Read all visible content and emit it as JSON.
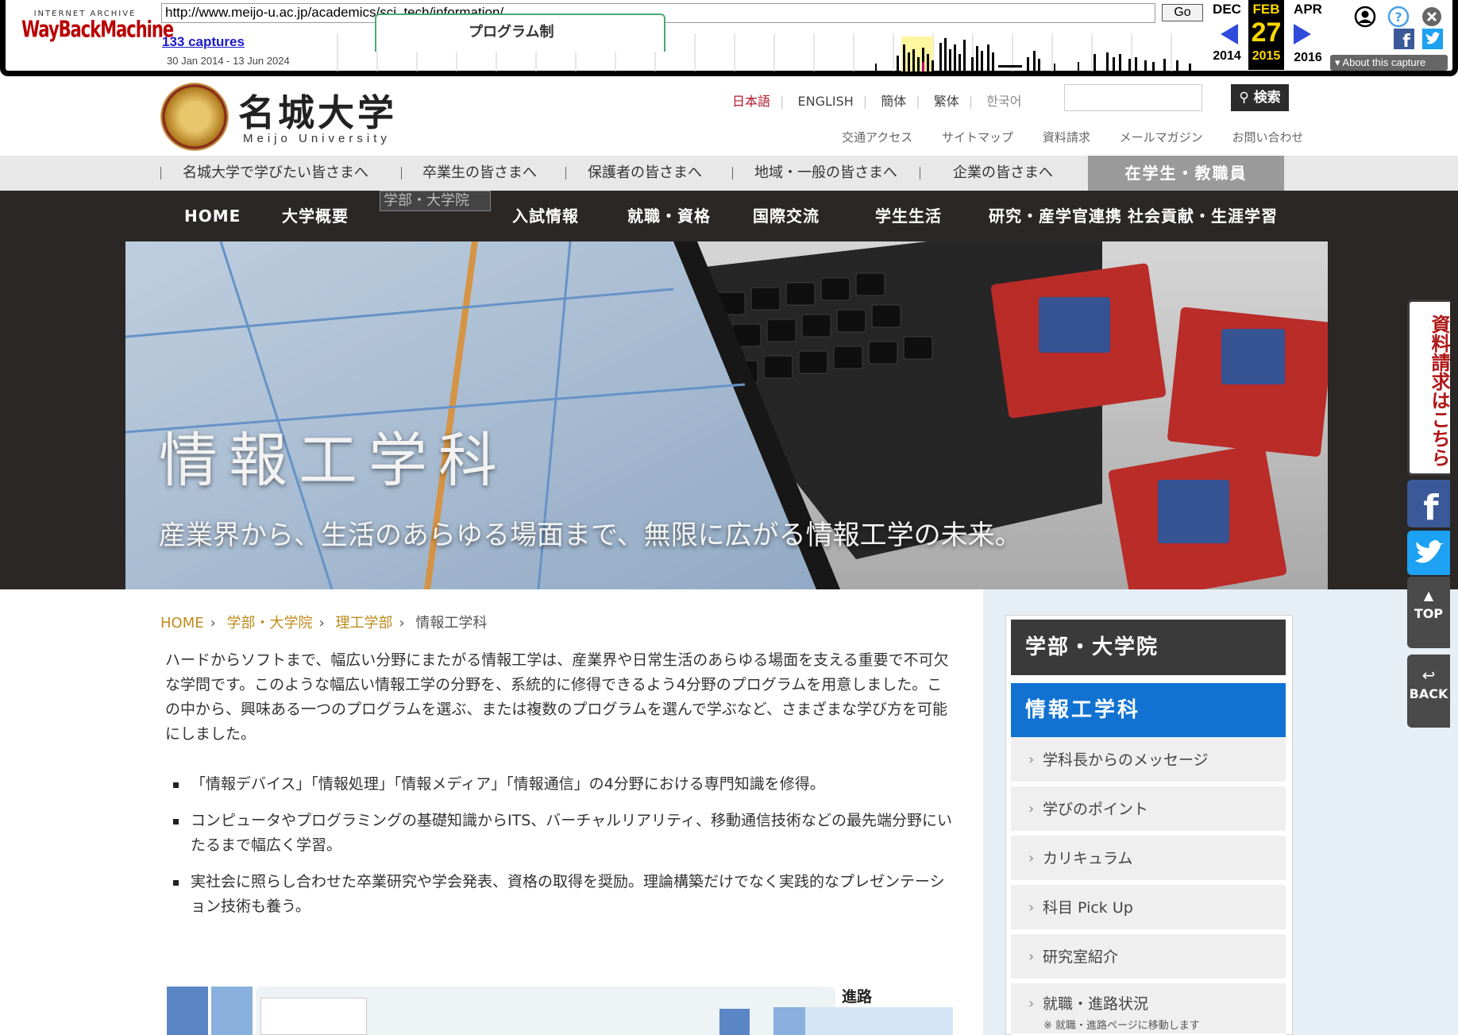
{
  "wayback": {
    "logo_top": "INTERNET ARCHIVE",
    "logo_main": "WayBackMachine",
    "url": "http://www.meijo-u.ac.jp/academics/sci_tech/information/",
    "go": "Go",
    "captures": "133 captures",
    "range": "30 Jan 2014 - 13 Jun 2024",
    "prev_month": "DEC",
    "cur_month": "FEB",
    "next_month": "APR",
    "day": "27",
    "prev_year": "2014",
    "cur_year": "2015",
    "next_year": "2016",
    "about": "About this capture",
    "accent": "#ffd700"
  },
  "header": {
    "logo_ja": "名城大学",
    "logo_en": "Meijo University",
    "languages": [
      "日本語",
      "ENGLISH",
      "簡体",
      "繁体",
      "한국어"
    ],
    "search_button": "検索",
    "utility_links": [
      "交通アクセス",
      "サイトマップ",
      "資料請求",
      "メールマガジン",
      "お問い合わせ"
    ]
  },
  "audience_nav": {
    "items": [
      "名城大学で学びたい皆さまへ",
      "卒業生の皆さまへ",
      "保護者の皆さまへ",
      "地域・一般の皆さまへ",
      "企業の皆さまへ"
    ],
    "current": "在学生・教職員"
  },
  "global_nav": {
    "items": [
      "HOME",
      "大学概要",
      "入試情報",
      "就職・資格",
      "国際交流",
      "学生生活",
      "研究・産学官連携",
      "社会貢献・生涯学習"
    ],
    "broken_image_alt": "学部・大学院"
  },
  "hero": {
    "title": "情報工学科",
    "subtitle": "産業界から、生活のあらゆる場面まで、無限に広がる情報工学の未来。"
  },
  "side_widgets": {
    "request": "資料請求はこちら",
    "top": "TOP",
    "back": "BACK",
    "facebook_color": "#3b5998",
    "twitter_color": "#1da1f2"
  },
  "breadcrumb": [
    "HOME",
    "学部・大学院",
    "理工学部",
    "情報工学科"
  ],
  "intro": "ハードからソフトまで、幅広い分野にまたがる情報工学は、産業界や日常生活のあらゆる場面を支える重要で不可欠な学問です。このような幅広い情報工学の分野を、系統的に修得できるよう4分野のプログラムを用意しました。この中から、興味ある一つのプログラムを選ぶ、または複数のプログラムを選んで学ぶなど、さまざまな学び方を可能にしました。",
  "bullets": [
    "「情報デバイス」「情報処理」「情報メディア」「情報通信」の4分野における専門知識を修得。",
    "コンピュータやプログラミングの基礎知識からITS、バーチャルリアリティ、移動通信技術などの最先端分野にいたるまで幅広く学習。",
    "実社会に照らし合わせた卒業研究や学会発表、資格の取得を奨励。理論構築だけでなく実践的なプレゼンテーション技術も養う。"
  ],
  "diagram": {
    "program_label": "プログラム制",
    "career_label": "進路"
  },
  "sidebar": {
    "heading": "学部・大学院",
    "current": "情報工学科",
    "items": [
      "学科長からのメッセージ",
      "学びのポイント",
      "カリキュラム",
      "科目 Pick Up",
      "研究室紹介",
      "就職・進路状況"
    ],
    "note": "※ 就職・進路ページに移動します"
  }
}
